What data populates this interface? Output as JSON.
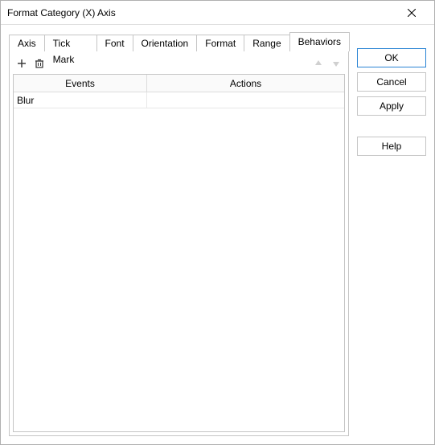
{
  "window": {
    "title": "Format Category (X) Axis"
  },
  "tabs": [
    {
      "label": "Axis"
    },
    {
      "label": "Tick Mark"
    },
    {
      "label": "Font"
    },
    {
      "label": "Orientation"
    },
    {
      "label": "Format"
    },
    {
      "label": "Range"
    },
    {
      "label": "Behaviors",
      "active": true
    }
  ],
  "table": {
    "headers": {
      "events": "Events",
      "actions": "Actions"
    },
    "rows": [
      {
        "event": "Blur",
        "action": ""
      }
    ]
  },
  "buttons": {
    "ok": "OK",
    "cancel": "Cancel",
    "apply": "Apply",
    "help": "Help"
  }
}
